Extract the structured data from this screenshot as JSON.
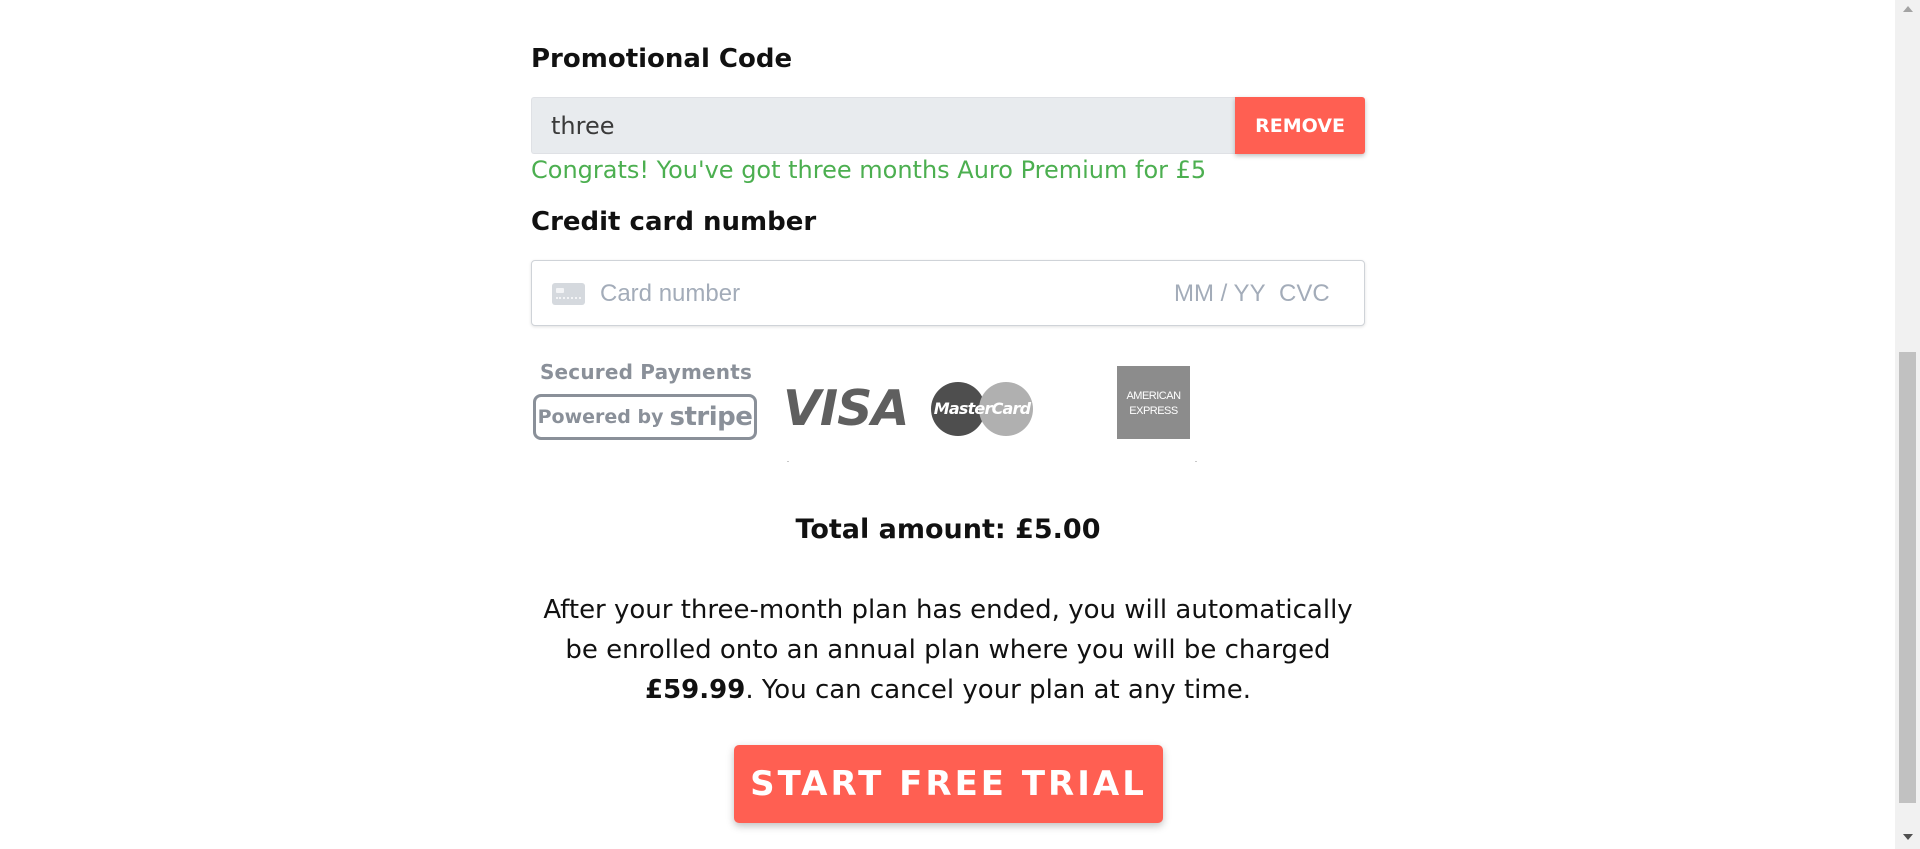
{
  "promo": {
    "label": "Promotional Code",
    "value": "three",
    "remove_label": "REMOVE",
    "success_message": "Congrats! You've got three months Auro Premium for £5"
  },
  "card": {
    "label": "Credit card number",
    "number_placeholder": "Card number",
    "expiry_placeholder": "MM / YY",
    "cvc_placeholder": "CVC"
  },
  "security": {
    "secured_text": "Secured Payments",
    "powered_by": "Powered by",
    "stripe": "stripe"
  },
  "brands": {
    "visa": "VISA",
    "mastercard": "MasterCard",
    "amex_line1": "AMERICAN",
    "amex_line2": "EXPRESS"
  },
  "summary": {
    "total": "Total amount: £5.00",
    "plan_before": "After your three-month plan has ended, you will automatically be enrolled onto an annual plan where you will be charged ",
    "plan_price": "£59.99",
    "plan_after": ". You can cancel your plan at any time."
  },
  "cta": {
    "label": "START FREE TRIAL"
  },
  "colors": {
    "accent": "#ff5f52",
    "success": "#4caf50"
  },
  "icons": {
    "card": "credit-card-icon"
  }
}
